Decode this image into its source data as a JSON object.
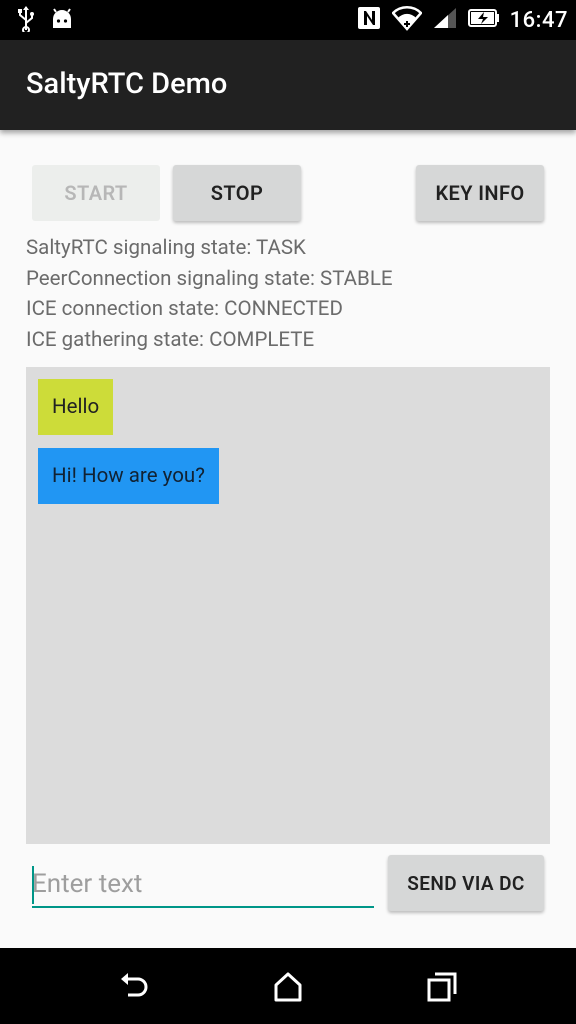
{
  "status_bar": {
    "time": "16:47",
    "icons": [
      "usb-icon",
      "android-debug-icon",
      "nfc-icon",
      "wifi-icon",
      "cell-signal-icon",
      "battery-charging-icon"
    ]
  },
  "app_bar": {
    "title": "SaltyRTC Demo"
  },
  "controls": {
    "start_label": "START",
    "stop_label": "STOP",
    "key_info_label": "KEY INFO"
  },
  "states": {
    "saltyrtc": "SaltyRTC signaling state: TASK",
    "peer_connection": "PeerConnection signaling state: STABLE",
    "ice_connection": "ICE connection state: CONNECTED",
    "ice_gathering": "ICE gathering state: COMPLETE"
  },
  "messages": [
    {
      "text": "Hello",
      "color": "#cddc39"
    },
    {
      "text": "Hi! How are you?",
      "color": "#2196f3"
    }
  ],
  "composer": {
    "placeholder": "Enter text",
    "value": "",
    "send_label": "SEND VIA DC",
    "accent": "#009688"
  },
  "nav_bar": {
    "icons": [
      "back-icon",
      "home-icon",
      "recents-icon"
    ]
  }
}
